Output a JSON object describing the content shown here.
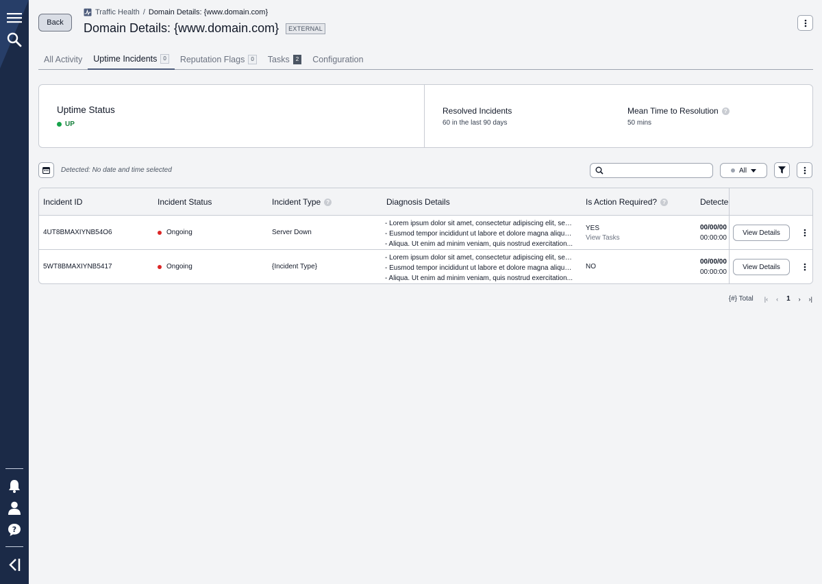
{
  "sidebar": {
    "top_icons": [
      "menu-icon",
      "search-icon"
    ],
    "bottom_icons": [
      "bell-icon",
      "user-icon",
      "help-icon",
      "collapse-icon"
    ]
  },
  "header": {
    "back_label": "Back",
    "breadcrumb": {
      "parent": "Traffic Health",
      "separator": "/",
      "current": "Domain Details: {www.domain.com}"
    },
    "title_prefix": "Domain Details:",
    "title_domain": " {www.domain.com}",
    "tag": "EXTERNAL"
  },
  "tabs": [
    {
      "label": "All Activity",
      "count": ""
    },
    {
      "label": "Uptime Incidents",
      "count": "0"
    },
    {
      "label": "Reputation Flags",
      "count": "0"
    },
    {
      "label": "Tasks",
      "count": "2"
    },
    {
      "label": "Configuration",
      "count": ""
    }
  ],
  "stats": {
    "uptime_label": "Uptime Status",
    "uptime_value": "UP",
    "resolved_label": "Resolved Incidents",
    "resolved_value": "60 in the last 90 days",
    "mttr_label": "Mean Time to Resolution",
    "mttr_value": "50 mins"
  },
  "toolbar": {
    "detected_text": "Detected: No date and time selected",
    "search_placeholder": "",
    "filter_value": "All"
  },
  "table": {
    "headers": [
      "Incident ID",
      "Incident Status",
      "Incident Type",
      "Diagnosis Details",
      "Is Action Required?",
      "Detected"
    ],
    "rows": [
      {
        "id": "4UT8BMAXIYNB54O6",
        "status": "Ongoing",
        "type": "Server Down",
        "diagnosis": [
          "- Lorem ipsum dolor sit amet, consectetur adipiscing elit, sed...",
          "- Eusmod tempor incididunt ut labore et dolore magna aliqua....",
          "- Aliqua. Ut enim ad minim veniam, quis nostrud exercitation..."
        ],
        "action": "YES",
        "action_link": "View Tasks",
        "date": "00/00/00",
        "time": "00:00:00",
        "button": "View Details"
      },
      {
        "id": "5WT8BMAXIYNB5417",
        "status": "Ongoing",
        "type": "{Incident Type}",
        "diagnosis": [
          "- Lorem ipsum dolor sit amet, consectetur adipiscing elit, sed...",
          "- Eusmod tempor incididunt ut labore et dolore magna aliqua....",
          "- Aliqua. Ut enim ad minim veniam, quis nostrud exercitation..."
        ],
        "action": "NO",
        "action_link": "",
        "date": "00/00/00",
        "time": "00:00:00",
        "button": "View Details"
      }
    ]
  },
  "pagination": {
    "total": "{#} Total",
    "current": "1"
  },
  "colors": {
    "sidebar": "#1b2a47",
    "status_up": "#16a34a",
    "status_ongoing": "#dc2626"
  }
}
